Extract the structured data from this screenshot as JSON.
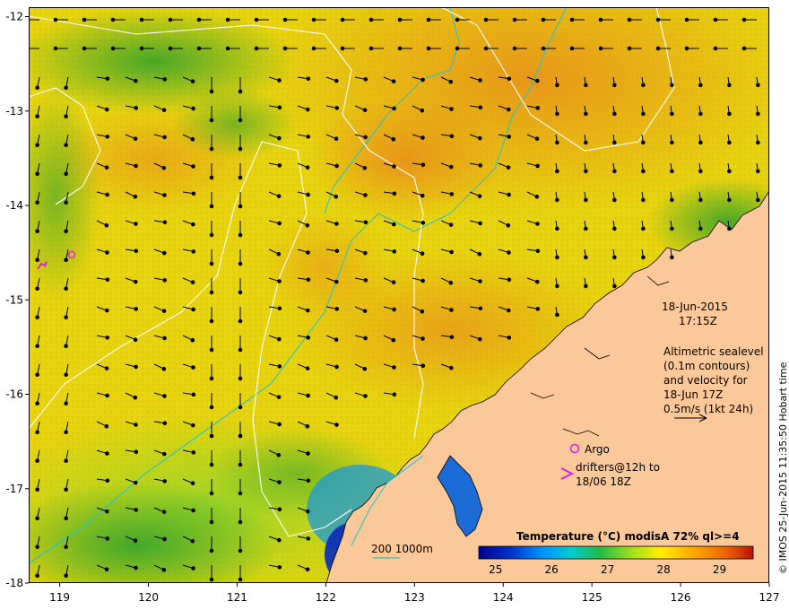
{
  "map": {
    "lat_ticks": [
      "-12",
      "-13",
      "-14",
      "-15",
      "-16",
      "-17",
      "-18"
    ],
    "lon_ticks": [
      "119",
      "120",
      "121",
      "122",
      "123",
      "124",
      "125",
      "126",
      "127"
    ],
    "lat_range": [
      -18,
      -11.9
    ],
    "lon_range": [
      118.65,
      127
    ]
  },
  "annotations": {
    "date": "18-Jun-2015",
    "time": "17:15Z",
    "altimetry": [
      "Altimetric sealevel",
      "(0.1m contours)",
      "and velocity for",
      "18-Jun 17Z"
    ],
    "scale_vector": "0.5m/s (1kt 24h)",
    "argo": "Argo",
    "drifters": [
      "drifters@12h to",
      "18/06 18Z"
    ],
    "bathymetry": "200  1000m"
  },
  "colorbar": {
    "title": "Temperature (°C) modisA 72% ql>=4",
    "ticks": [
      "25",
      "26",
      "27",
      "28",
      "29"
    ],
    "range": [
      24.7,
      29.6
    ],
    "colors": [
      "#00008b",
      "#0033cc",
      "#0099ff",
      "#00cccc",
      "#22bb44",
      "#99dd22",
      "#ffee00",
      "#ffaa00",
      "#ee6600",
      "#bb1100"
    ]
  },
  "credit": "© IMOS 25-Jun-2015 11:35:50 Hobart time",
  "colors": {
    "land": "#fbc89a",
    "sst_warm": "#f5a623",
    "sst_mid": "#e8d90a",
    "sst_cool": "#2ca02c",
    "contour": "#ffffff",
    "bathy": "#27c5c8",
    "argo": "#e020e0",
    "vector": "#000000"
  }
}
